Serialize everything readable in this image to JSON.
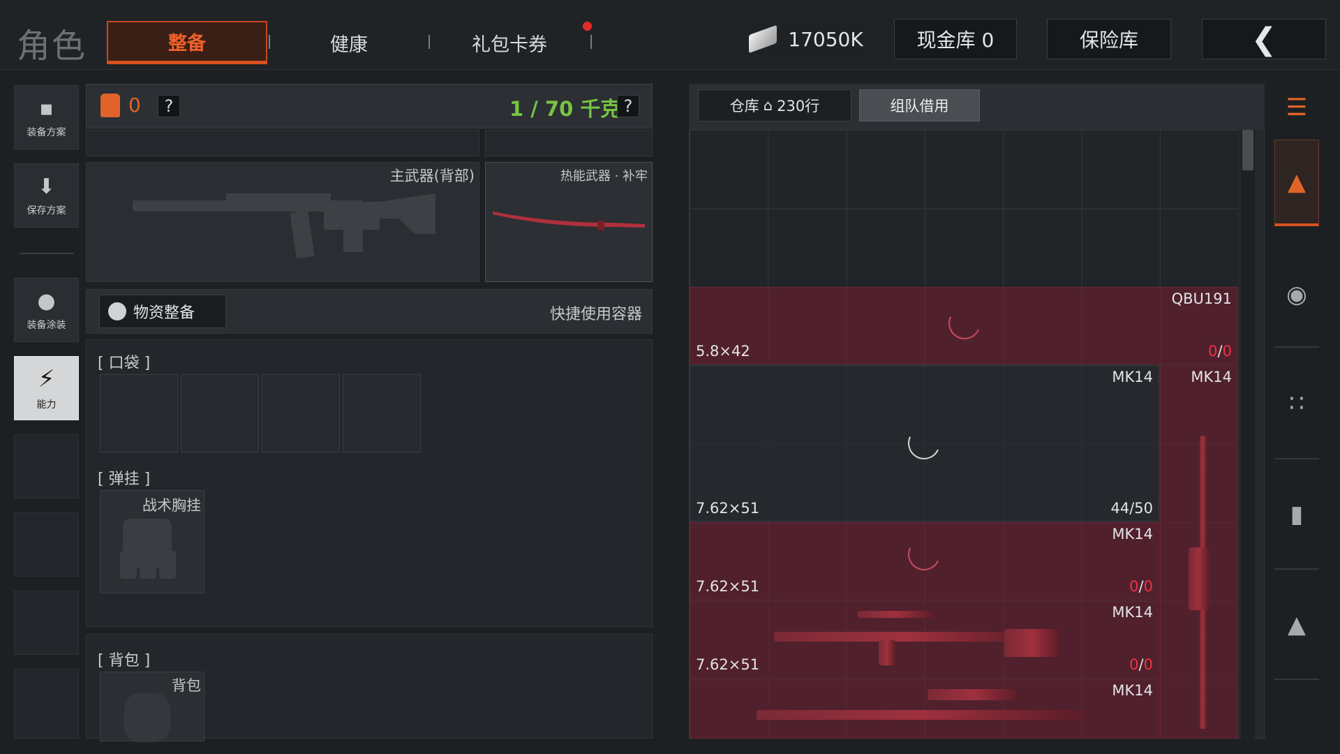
{
  "header": {
    "title": "角色",
    "tabs": [
      {
        "label": "整备",
        "active": true
      },
      {
        "label": "健康",
        "active": false
      },
      {
        "label": "礼包卡券",
        "active": false,
        "notification_dot": true
      }
    ],
    "currency": {
      "icon": "cash-bill-icon",
      "amount": "17050K"
    },
    "cash_vault": "现金库 0",
    "safe_vault": "保险库",
    "back_icon": "chevron-left-icon"
  },
  "sidebar": {
    "items": [
      {
        "label": "装备方案",
        "icon": "vest-icon"
      },
      {
        "label": "保存方案",
        "icon": "download-icon"
      },
      {
        "label": "装备涂装",
        "icon": "helmet-skin-icon"
      },
      {
        "label": "能力",
        "icon": "lightning-shield-icon",
        "active": true
      }
    ]
  },
  "loadout": {
    "armor_count": "0",
    "help": "?",
    "weight": "1 / 70 千克",
    "primary_label": "主武器(背部)",
    "thermal_label": "热能武器 · 补牢",
    "supply_button": "物资整备",
    "quick_container": "快捷使用容器",
    "pocket_label": "[ 口袋 ]",
    "rig_section_label": "[ 弹挂 ]",
    "rig_item": "战术胸挂",
    "backpack_section_label": "[ 背包 ]",
    "backpack_item": "背包"
  },
  "warehouse": {
    "tab_label": "仓库",
    "rows": "230行",
    "team_tab": "组队借用",
    "items": [
      {
        "name": "QBU191",
        "caliber": "5.8×42",
        "ammo_current": "0",
        "ammo_max": "0",
        "empty": true
      },
      {
        "name": "MK14",
        "caliber": "7.62×51",
        "ammo_current": "44",
        "ammo_max": "50",
        "empty": false,
        "ammo_text": "44/50"
      },
      {
        "name": "MK14",
        "caliber": "",
        "vertical": true
      },
      {
        "name": "MK14",
        "caliber": "7.62×51",
        "ammo_current": "0",
        "ammo_max": "0",
        "empty": true
      },
      {
        "name": "MK14",
        "caliber": "7.62×51",
        "ammo_current": "0",
        "ammo_max": "0",
        "empty": true
      },
      {
        "name": "MK14",
        "caliber": "",
        "partial": true
      }
    ]
  },
  "right_strip": {
    "icons": [
      "storage-stack-icon",
      "backpack-stack-icon",
      "helmet-icon",
      "rifle-icon",
      "magazine-icon",
      "bullet-icon"
    ]
  },
  "colors": {
    "accent": "#d9531f",
    "weight_green": "#77c443",
    "item_red": "#781e32",
    "zero_ammo": "#ee3344"
  }
}
